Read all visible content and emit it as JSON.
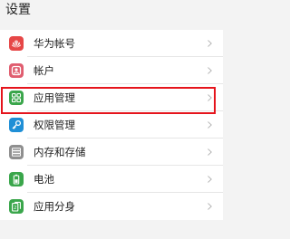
{
  "header": {
    "title": "设置"
  },
  "settings": {
    "items": [
      {
        "label": "华为帐号",
        "icon": "huawei-logo-icon",
        "color": "#e64747"
      },
      {
        "label": "帐户",
        "icon": "person-icon",
        "color": "#e05d6f"
      },
      {
        "label": "应用管理",
        "icon": "app-grid-icon",
        "color": "#3aa64b"
      },
      {
        "label": "权限管理",
        "icon": "key-icon",
        "color": "#1f8fd6"
      },
      {
        "label": "内存和存储",
        "icon": "storage-icon",
        "color": "#8f8f8f"
      },
      {
        "label": "电池",
        "icon": "battery-icon",
        "color": "#3aa64b"
      },
      {
        "label": "应用分身",
        "icon": "app-twin-icon",
        "color": "#3aa64b"
      }
    ]
  },
  "highlight": {
    "target": "应用管理",
    "color": "#e5141c"
  }
}
